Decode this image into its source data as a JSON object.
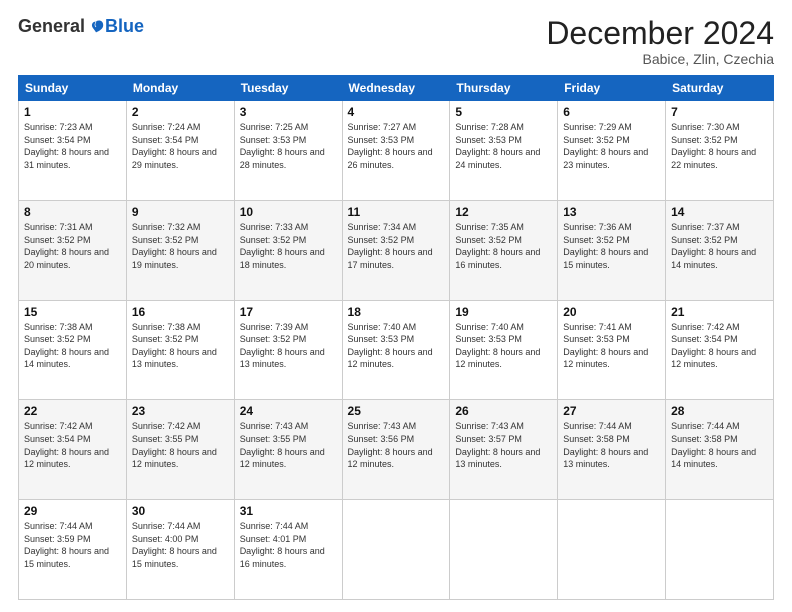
{
  "logo": {
    "general": "General",
    "blue": "Blue"
  },
  "title": "December 2024",
  "location": "Babice, Zlin, Czechia",
  "days_header": [
    "Sunday",
    "Monday",
    "Tuesday",
    "Wednesday",
    "Thursday",
    "Friday",
    "Saturday"
  ],
  "weeks": [
    [
      {
        "day": "1",
        "sunrise": "Sunrise: 7:23 AM",
        "sunset": "Sunset: 3:54 PM",
        "daylight": "Daylight: 8 hours and 31 minutes."
      },
      {
        "day": "2",
        "sunrise": "Sunrise: 7:24 AM",
        "sunset": "Sunset: 3:54 PM",
        "daylight": "Daylight: 8 hours and 29 minutes."
      },
      {
        "day": "3",
        "sunrise": "Sunrise: 7:25 AM",
        "sunset": "Sunset: 3:53 PM",
        "daylight": "Daylight: 8 hours and 28 minutes."
      },
      {
        "day": "4",
        "sunrise": "Sunrise: 7:27 AM",
        "sunset": "Sunset: 3:53 PM",
        "daylight": "Daylight: 8 hours and 26 minutes."
      },
      {
        "day": "5",
        "sunrise": "Sunrise: 7:28 AM",
        "sunset": "Sunset: 3:53 PM",
        "daylight": "Daylight: 8 hours and 24 minutes."
      },
      {
        "day": "6",
        "sunrise": "Sunrise: 7:29 AM",
        "sunset": "Sunset: 3:52 PM",
        "daylight": "Daylight: 8 hours and 23 minutes."
      },
      {
        "day": "7",
        "sunrise": "Sunrise: 7:30 AM",
        "sunset": "Sunset: 3:52 PM",
        "daylight": "Daylight: 8 hours and 22 minutes."
      }
    ],
    [
      {
        "day": "8",
        "sunrise": "Sunrise: 7:31 AM",
        "sunset": "Sunset: 3:52 PM",
        "daylight": "Daylight: 8 hours and 20 minutes."
      },
      {
        "day": "9",
        "sunrise": "Sunrise: 7:32 AM",
        "sunset": "Sunset: 3:52 PM",
        "daylight": "Daylight: 8 hours and 19 minutes."
      },
      {
        "day": "10",
        "sunrise": "Sunrise: 7:33 AM",
        "sunset": "Sunset: 3:52 PM",
        "daylight": "Daylight: 8 hours and 18 minutes."
      },
      {
        "day": "11",
        "sunrise": "Sunrise: 7:34 AM",
        "sunset": "Sunset: 3:52 PM",
        "daylight": "Daylight: 8 hours and 17 minutes."
      },
      {
        "day": "12",
        "sunrise": "Sunrise: 7:35 AM",
        "sunset": "Sunset: 3:52 PM",
        "daylight": "Daylight: 8 hours and 16 minutes."
      },
      {
        "day": "13",
        "sunrise": "Sunrise: 7:36 AM",
        "sunset": "Sunset: 3:52 PM",
        "daylight": "Daylight: 8 hours and 15 minutes."
      },
      {
        "day": "14",
        "sunrise": "Sunrise: 7:37 AM",
        "sunset": "Sunset: 3:52 PM",
        "daylight": "Daylight: 8 hours and 14 minutes."
      }
    ],
    [
      {
        "day": "15",
        "sunrise": "Sunrise: 7:38 AM",
        "sunset": "Sunset: 3:52 PM",
        "daylight": "Daylight: 8 hours and 14 minutes."
      },
      {
        "day": "16",
        "sunrise": "Sunrise: 7:38 AM",
        "sunset": "Sunset: 3:52 PM",
        "daylight": "Daylight: 8 hours and 13 minutes."
      },
      {
        "day": "17",
        "sunrise": "Sunrise: 7:39 AM",
        "sunset": "Sunset: 3:52 PM",
        "daylight": "Daylight: 8 hours and 13 minutes."
      },
      {
        "day": "18",
        "sunrise": "Sunrise: 7:40 AM",
        "sunset": "Sunset: 3:53 PM",
        "daylight": "Daylight: 8 hours and 12 minutes."
      },
      {
        "day": "19",
        "sunrise": "Sunrise: 7:40 AM",
        "sunset": "Sunset: 3:53 PM",
        "daylight": "Daylight: 8 hours and 12 minutes."
      },
      {
        "day": "20",
        "sunrise": "Sunrise: 7:41 AM",
        "sunset": "Sunset: 3:53 PM",
        "daylight": "Daylight: 8 hours and 12 minutes."
      },
      {
        "day": "21",
        "sunrise": "Sunrise: 7:42 AM",
        "sunset": "Sunset: 3:54 PM",
        "daylight": "Daylight: 8 hours and 12 minutes."
      }
    ],
    [
      {
        "day": "22",
        "sunrise": "Sunrise: 7:42 AM",
        "sunset": "Sunset: 3:54 PM",
        "daylight": "Daylight: 8 hours and 12 minutes."
      },
      {
        "day": "23",
        "sunrise": "Sunrise: 7:42 AM",
        "sunset": "Sunset: 3:55 PM",
        "daylight": "Daylight: 8 hours and 12 minutes."
      },
      {
        "day": "24",
        "sunrise": "Sunrise: 7:43 AM",
        "sunset": "Sunset: 3:55 PM",
        "daylight": "Daylight: 8 hours and 12 minutes."
      },
      {
        "day": "25",
        "sunrise": "Sunrise: 7:43 AM",
        "sunset": "Sunset: 3:56 PM",
        "daylight": "Daylight: 8 hours and 12 minutes."
      },
      {
        "day": "26",
        "sunrise": "Sunrise: 7:43 AM",
        "sunset": "Sunset: 3:57 PM",
        "daylight": "Daylight: 8 hours and 13 minutes."
      },
      {
        "day": "27",
        "sunrise": "Sunrise: 7:44 AM",
        "sunset": "Sunset: 3:58 PM",
        "daylight": "Daylight: 8 hours and 13 minutes."
      },
      {
        "day": "28",
        "sunrise": "Sunrise: 7:44 AM",
        "sunset": "Sunset: 3:58 PM",
        "daylight": "Daylight: 8 hours and 14 minutes."
      }
    ],
    [
      {
        "day": "29",
        "sunrise": "Sunrise: 7:44 AM",
        "sunset": "Sunset: 3:59 PM",
        "daylight": "Daylight: 8 hours and 15 minutes."
      },
      {
        "day": "30",
        "sunrise": "Sunrise: 7:44 AM",
        "sunset": "Sunset: 4:00 PM",
        "daylight": "Daylight: 8 hours and 15 minutes."
      },
      {
        "day": "31",
        "sunrise": "Sunrise: 7:44 AM",
        "sunset": "Sunset: 4:01 PM",
        "daylight": "Daylight: 8 hours and 16 minutes."
      },
      null,
      null,
      null,
      null
    ]
  ]
}
